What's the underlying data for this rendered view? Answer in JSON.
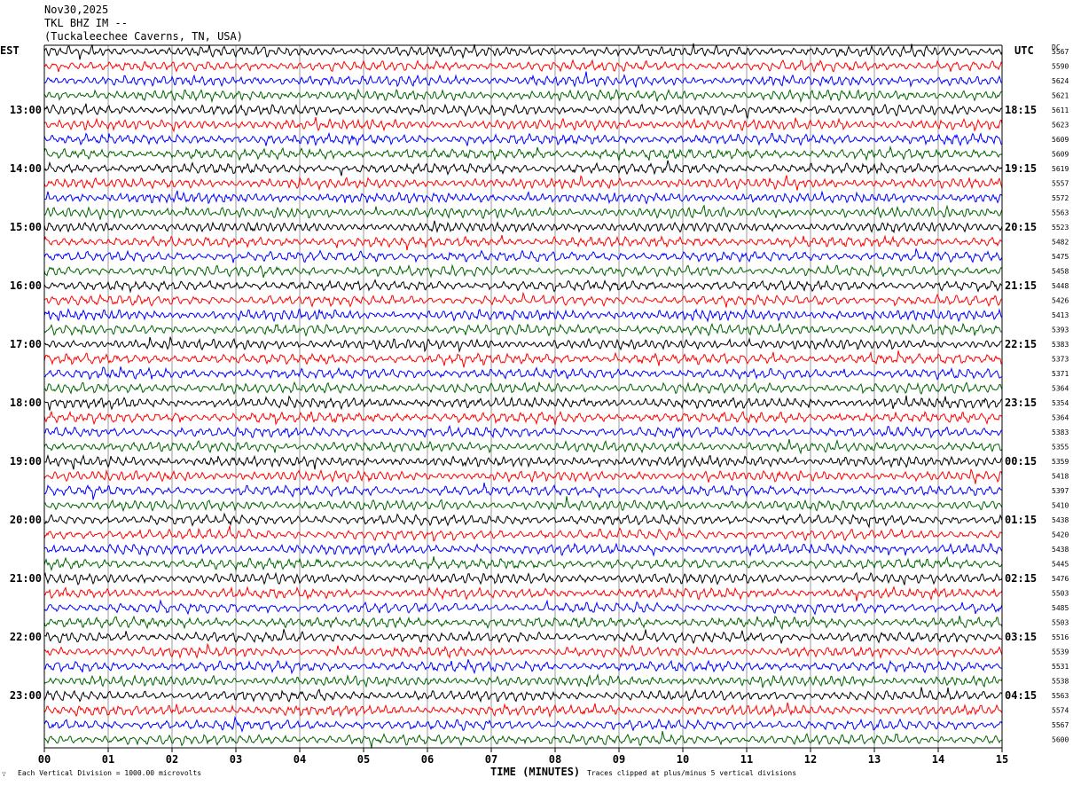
{
  "header": {
    "date": "Nov30,2025",
    "station": "TKL BHZ IM --",
    "location": "(Tuckaleechee Caverns, TN, USA)"
  },
  "left_corner_label": "EST",
  "right_corner_label": "UTC",
  "dc_label": "DC",
  "footer": {
    "scale_note": "Each Vertical Division = 1000.00 microvolts",
    "clip_note": "Traces clipped at plus/minus 5 vertical divisions",
    "icon": "small-glyph-icon"
  },
  "chart_data": {
    "type": "line",
    "title": "",
    "xlabel": "TIME (MINUTES)",
    "ylabel": "",
    "xlim": [
      0,
      15
    ],
    "x_ticks": [
      "00",
      "01",
      "02",
      "03",
      "04",
      "05",
      "06",
      "07",
      "08",
      "09",
      "10",
      "11",
      "12",
      "13",
      "14",
      "15"
    ],
    "grid": "vertical lines at each minute",
    "trace_colors": [
      "#000000",
      "#ff0000",
      "#0000ff",
      "#006400"
    ],
    "left_time_labels": [
      "13:00",
      "14:00",
      "15:00",
      "16:00",
      "17:00",
      "18:00",
      "19:00",
      "20:00",
      "21:00",
      "22:00",
      "23:00"
    ],
    "right_time_labels": [
      "18:15",
      "19:15",
      "20:15",
      "21:15",
      "22:15",
      "23:15",
      "00:15",
      "01:15",
      "02:15",
      "03:15",
      "04:15"
    ],
    "dc_offsets": [
      5567,
      5590,
      5624,
      5621,
      5611,
      5623,
      5609,
      5609,
      5619,
      5557,
      5572,
      5563,
      5523,
      5482,
      5475,
      5458,
      5448,
      5426,
      5413,
      5393,
      5383,
      5373,
      5371,
      5364,
      5354,
      5364,
      5383,
      5355,
      5359,
      5418,
      5397,
      5410,
      5438,
      5420,
      5438,
      5445,
      5476,
      5503,
      5485,
      5503,
      5516,
      5539,
      5531,
      5538,
      5563,
      5574,
      5567,
      5600
    ]
  }
}
